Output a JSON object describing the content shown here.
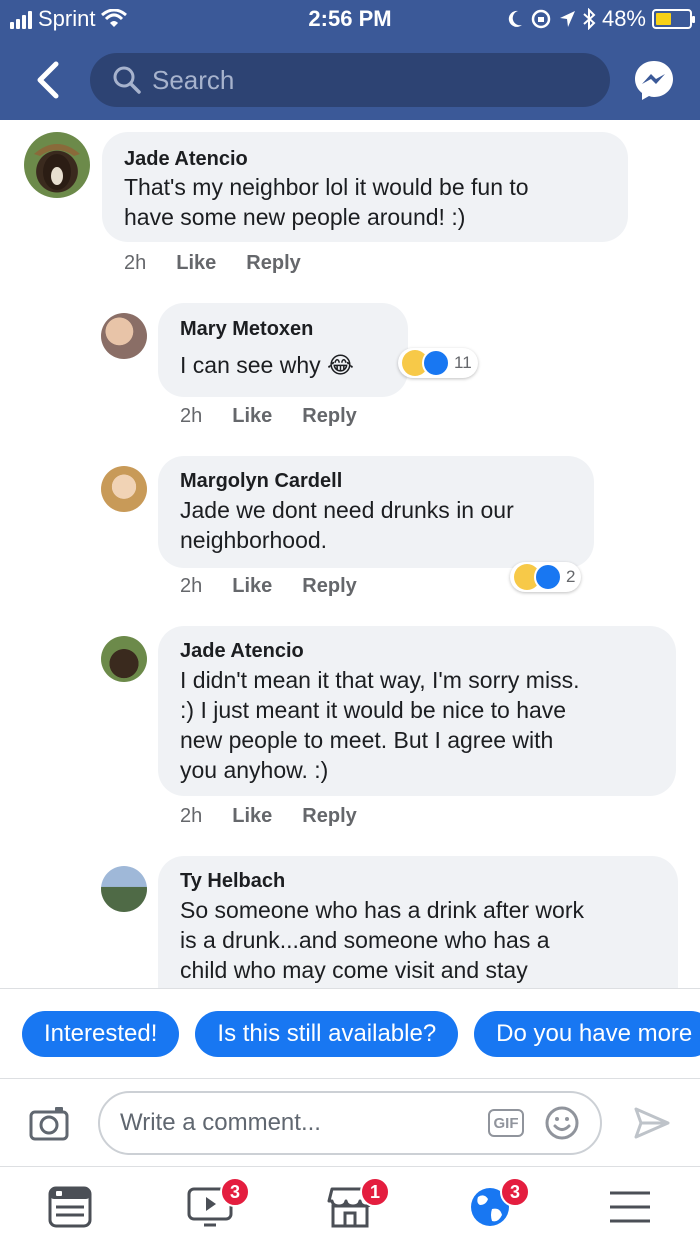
{
  "status_bar": {
    "carrier": "Sprint",
    "time": "2:56 PM",
    "battery_text": "48%",
    "battery_level": 0.48
  },
  "nav": {
    "search_placeholder": "Search",
    "back_icon": "chevron-left-icon",
    "messenger_icon": "messenger-icon"
  },
  "comments": [
    {
      "author": "Jade Atencio",
      "text": "That's my neighbor lol it would be fun to\nhave some new people around! :)",
      "time": "2h",
      "like_label": "Like",
      "reply_label": "Reply"
    },
    {
      "author": "Mary Metoxen",
      "text": "I can see why 😂",
      "time": "2h",
      "like_label": "Like",
      "reply_label": "Reply",
      "reaction_count": "11"
    },
    {
      "author": "Margolyn Cardell",
      "text": "Jade we dont need drunks in our\nneighborhood.",
      "time": "2h",
      "like_label": "Like",
      "reply_label": "Reply",
      "reaction_count": "2"
    },
    {
      "author": "Jade Atencio",
      "text": "I didn't mean it that way, I'm sorry miss.\n:) I just meant it would be nice to have\nnew people to meet. But I agree with\nyou anyhow. :)",
      "time": "2h",
      "like_label": "Like",
      "reply_label": "Reply"
    },
    {
      "author": "Ty Helbach",
      "text": "So someone who has a drink after work\nis a drunk...and someone who has a\nchild who may come visit and stay"
    }
  ],
  "quick_replies": [
    "Interested!",
    "Is this still available?",
    "Do you have more"
  ],
  "composer": {
    "placeholder": "Write a comment...",
    "gif_label": "GIF"
  },
  "tab_bar": {
    "tabs": [
      {
        "icon": "news-feed-icon",
        "badge": ""
      },
      {
        "icon": "video-icon",
        "badge": "3"
      },
      {
        "icon": "marketplace-icon",
        "badge": "1"
      },
      {
        "icon": "notifications-globe-icon",
        "badge": "3"
      },
      {
        "icon": "menu-icon",
        "badge": ""
      }
    ]
  },
  "colors": {
    "brand": "#3b5998",
    "accent": "#1877f2",
    "badge": "#e41e3f",
    "bubble": "#f0f2f5"
  }
}
